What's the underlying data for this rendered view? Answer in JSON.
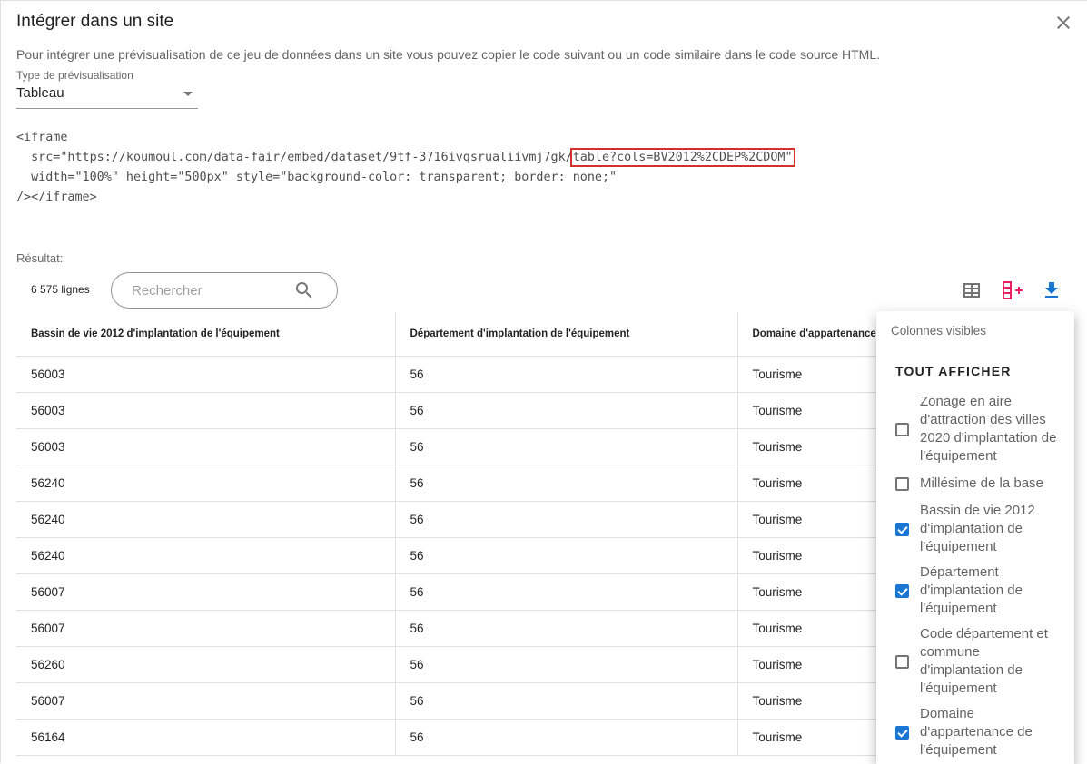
{
  "dialog": {
    "title": "Intégrer dans un site",
    "intro": "Pour intégrer une prévisualisation de ce jeu de données dans un site vous pouvez copier le code suivant ou un code similaire dans le code source HTML.",
    "preview_type_label": "Type de prévisualisation",
    "preview_type_value": "Tableau",
    "code": {
      "line1": "<iframe",
      "line2_prefix": "  src=\"https://koumoul.com/data-fair/embed/dataset/9tf-3716ivqsrualiivmj7gk/",
      "line2_highlight": "table?cols=BV2012%2CDEP%2CDOM\"",
      "line3": "  width=\"100%\" height=\"500px\" style=\"background-color: transparent; border: none;\"",
      "line4": "/></iframe>"
    },
    "result_label": "Résultat:"
  },
  "toolbar": {
    "row_count": "6 575 lignes",
    "search_placeholder": "Rechercher"
  },
  "table": {
    "headers": [
      "Bassin de vie 2012 d'implantation de l'équipement",
      "Département d'implantation de l'équipement",
      "Domaine d'appartenance de l'équipement"
    ],
    "rows": [
      [
        "56003",
        "56",
        "Tourisme"
      ],
      [
        "56003",
        "56",
        "Tourisme"
      ],
      [
        "56003",
        "56",
        "Tourisme"
      ],
      [
        "56240",
        "56",
        "Tourisme"
      ],
      [
        "56240",
        "56",
        "Tourisme"
      ],
      [
        "56240",
        "56",
        "Tourisme"
      ],
      [
        "56007",
        "56",
        "Tourisme"
      ],
      [
        "56007",
        "56",
        "Tourisme"
      ],
      [
        "56260",
        "56",
        "Tourisme"
      ],
      [
        "56007",
        "56",
        "Tourisme"
      ],
      [
        "56164",
        "56",
        "Tourisme"
      ]
    ]
  },
  "columns_menu": {
    "subheader": "Colonnes visibles",
    "show_all": "TOUT AFFICHER",
    "options": [
      {
        "label": "Zonage en aire d'attraction des villes 2020 d'implantation de l'équipement",
        "checked": false
      },
      {
        "label": "Millésime de la base",
        "checked": false
      },
      {
        "label": "Bassin de vie 2012 d'implantation de l'équipement",
        "checked": true
      },
      {
        "label": "Département d'implantation de l'équipement",
        "checked": true
      },
      {
        "label": "Code département et commune d'implantation de l'équipement",
        "checked": false
      },
      {
        "label": "Domaine d'appartenance de l'équipement",
        "checked": true
      }
    ]
  },
  "colors": {
    "accent": "#1976d2",
    "pink": "#e91e63",
    "highlight_border": "#d32f2f"
  }
}
